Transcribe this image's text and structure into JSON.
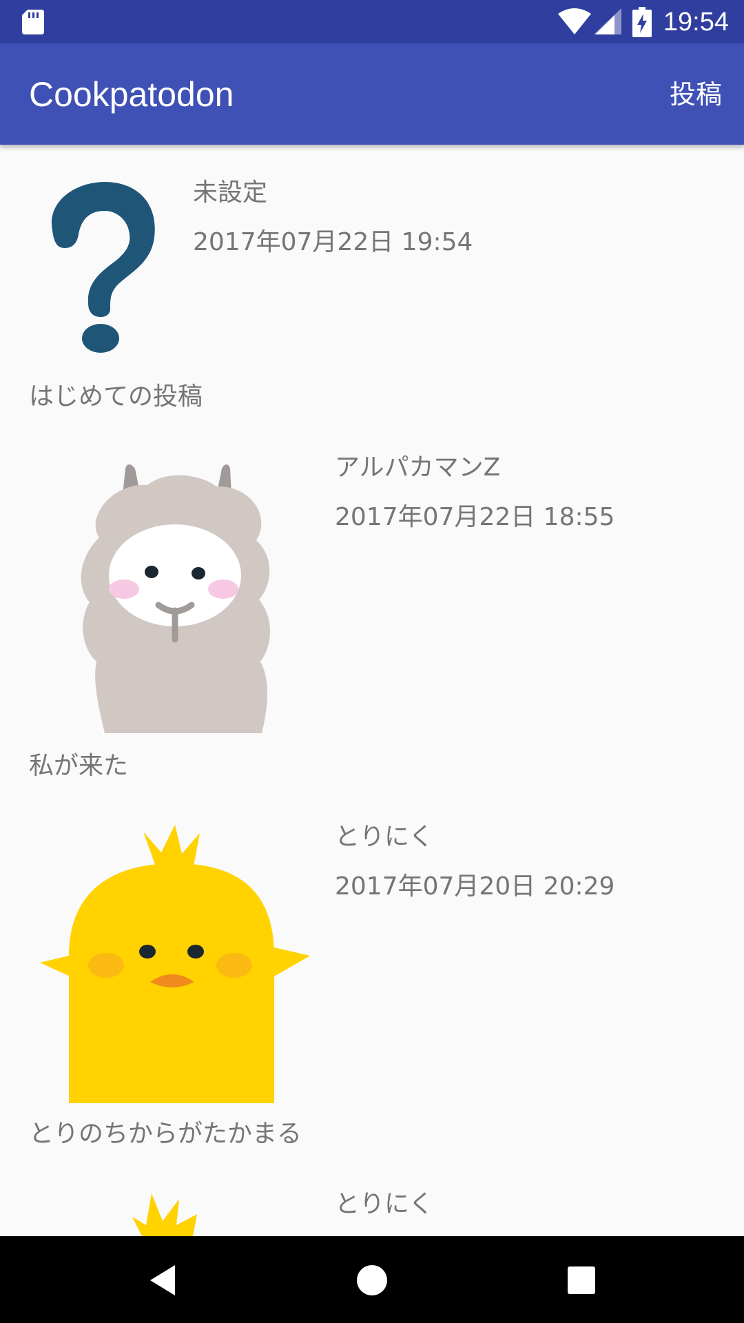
{
  "status_bar": {
    "time": "19:54",
    "icons": [
      "sd-card-icon",
      "wifi-icon",
      "cell-signal-icon",
      "battery-charging-icon"
    ]
  },
  "app_bar": {
    "title": "Cookpatodon",
    "action_label": "投稿"
  },
  "posts": [
    {
      "author": "未設定",
      "date": "2017年07月22日 19:54",
      "body": "はじめての投稿",
      "avatar": "question-mark-icon"
    },
    {
      "author": "アルパカマンZ",
      "date": "2017年07月22日 18:55",
      "body": "私が来た",
      "avatar": "alpaca-avatar"
    },
    {
      "author": "とりにく",
      "date": "2017年07月20日 20:29",
      "body": "とりのちからがたかまる",
      "avatar": "chick-avatar"
    },
    {
      "author": "とりにく",
      "avatar": "chick-avatar"
    }
  ],
  "nav_bar": {
    "buttons": [
      "back-icon",
      "home-icon",
      "recents-icon"
    ]
  },
  "colors": {
    "status_bar": "#303f9f",
    "app_bar": "#3f51b5",
    "background": "#fafafa",
    "text_secondary": "#757575",
    "question_mark": "#1f5577",
    "chick": "#ffd200",
    "alpaca_wool": "#d1c8c4"
  }
}
